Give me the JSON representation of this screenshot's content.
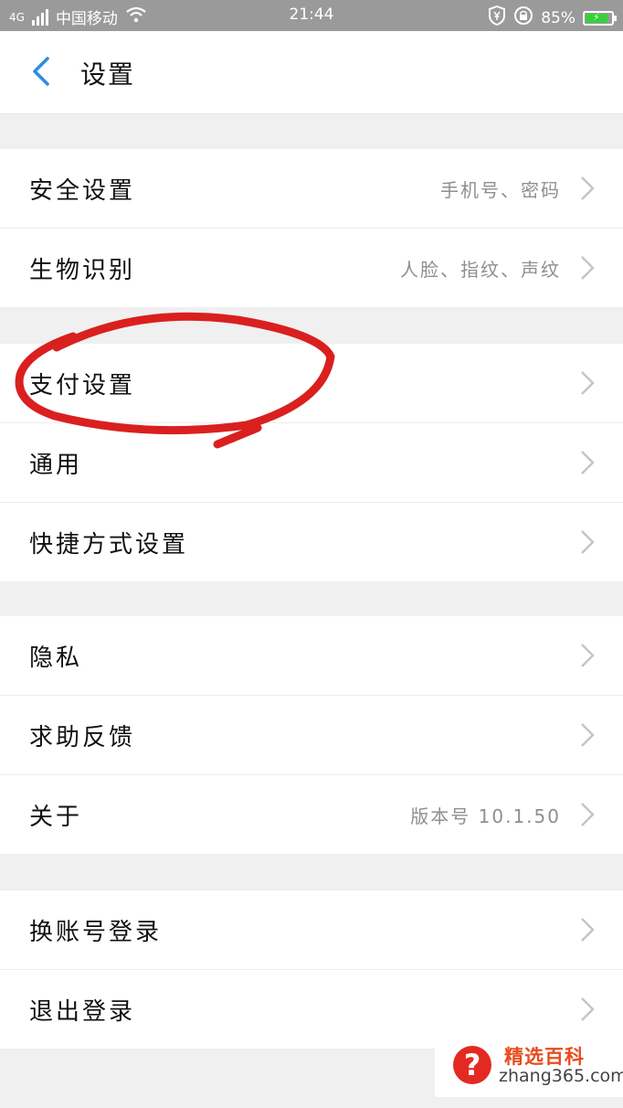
{
  "statusbar": {
    "network": "4G",
    "carrier": "中国移动",
    "time": "21:44",
    "battery": "85%",
    "icons": [
      "signal-icon",
      "wifi-icon",
      "shield-yen-icon",
      "lock-rotation-icon",
      "battery-icon"
    ]
  },
  "header": {
    "back_icon": "chevron-left-icon",
    "title": "设置"
  },
  "groups": [
    {
      "items": [
        {
          "label": "安全设置",
          "value": "手机号、密码"
        },
        {
          "label": "生物识别",
          "value": "人脸、指纹、声纹"
        }
      ]
    },
    {
      "items": [
        {
          "label": "支付设置",
          "value": ""
        },
        {
          "label": "通用",
          "value": ""
        },
        {
          "label": "快捷方式设置",
          "value": ""
        }
      ]
    },
    {
      "items": [
        {
          "label": "隐私",
          "value": ""
        },
        {
          "label": "求助反馈",
          "value": ""
        },
        {
          "label": "关于",
          "value": "版本号 10.1.50"
        }
      ]
    },
    {
      "items": [
        {
          "label": "换账号登录",
          "value": ""
        },
        {
          "label": "退出登录",
          "value": ""
        }
      ]
    }
  ],
  "watermark": {
    "icon_glyph": "?",
    "title": "精选百科",
    "url": "zhang365.com"
  },
  "colors": {
    "accent_blue": "#2a8ee6",
    "annotation_red": "#d9201f",
    "battery_green": "#36d13a"
  }
}
